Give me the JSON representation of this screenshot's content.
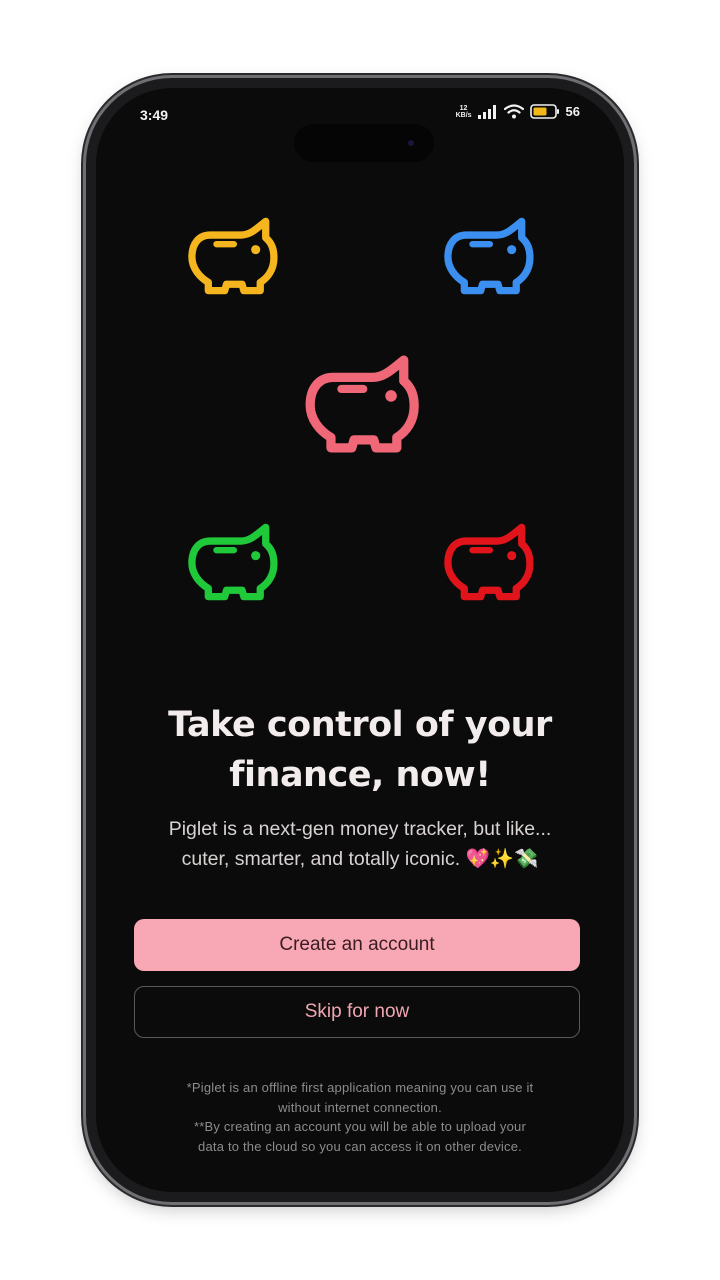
{
  "status_bar": {
    "time": "3:49",
    "network_speed_value": "12",
    "network_speed_unit": "KB/s",
    "battery": "56"
  },
  "icons": {
    "pigs": [
      {
        "name": "yellow-piggy-bank-icon",
        "color": "#f5b51e"
      },
      {
        "name": "blue-piggy-bank-icon",
        "color": "#3a8ff0"
      },
      {
        "name": "pink-piggy-bank-icon",
        "color": "#f06878"
      },
      {
        "name": "green-piggy-bank-icon",
        "color": "#1fc93a"
      },
      {
        "name": "red-piggy-bank-icon",
        "color": "#e0141a"
      }
    ]
  },
  "onboarding": {
    "headline_line1": "Take control of your",
    "headline_line2": "finance, now!",
    "subtitle_line1": "Piglet is a next-gen money tracker, but like...",
    "subtitle_line2": "cuter, smarter, and totally iconic. 💖✨💸",
    "create_account_label": "Create an account",
    "skip_label": "Skip for now",
    "footnote_line1": "*Piglet is an offline first application meaning you can use it",
    "footnote_line2": "without internet connection.",
    "footnote_line3": "**By creating an account you will be able to upload your",
    "footnote_line4": "data to the cloud so you can access it on other device."
  },
  "colors": {
    "primary_button": "#f7a8b4",
    "secondary_button_text": "#f0a6b2",
    "background": "#0b0b0b"
  }
}
